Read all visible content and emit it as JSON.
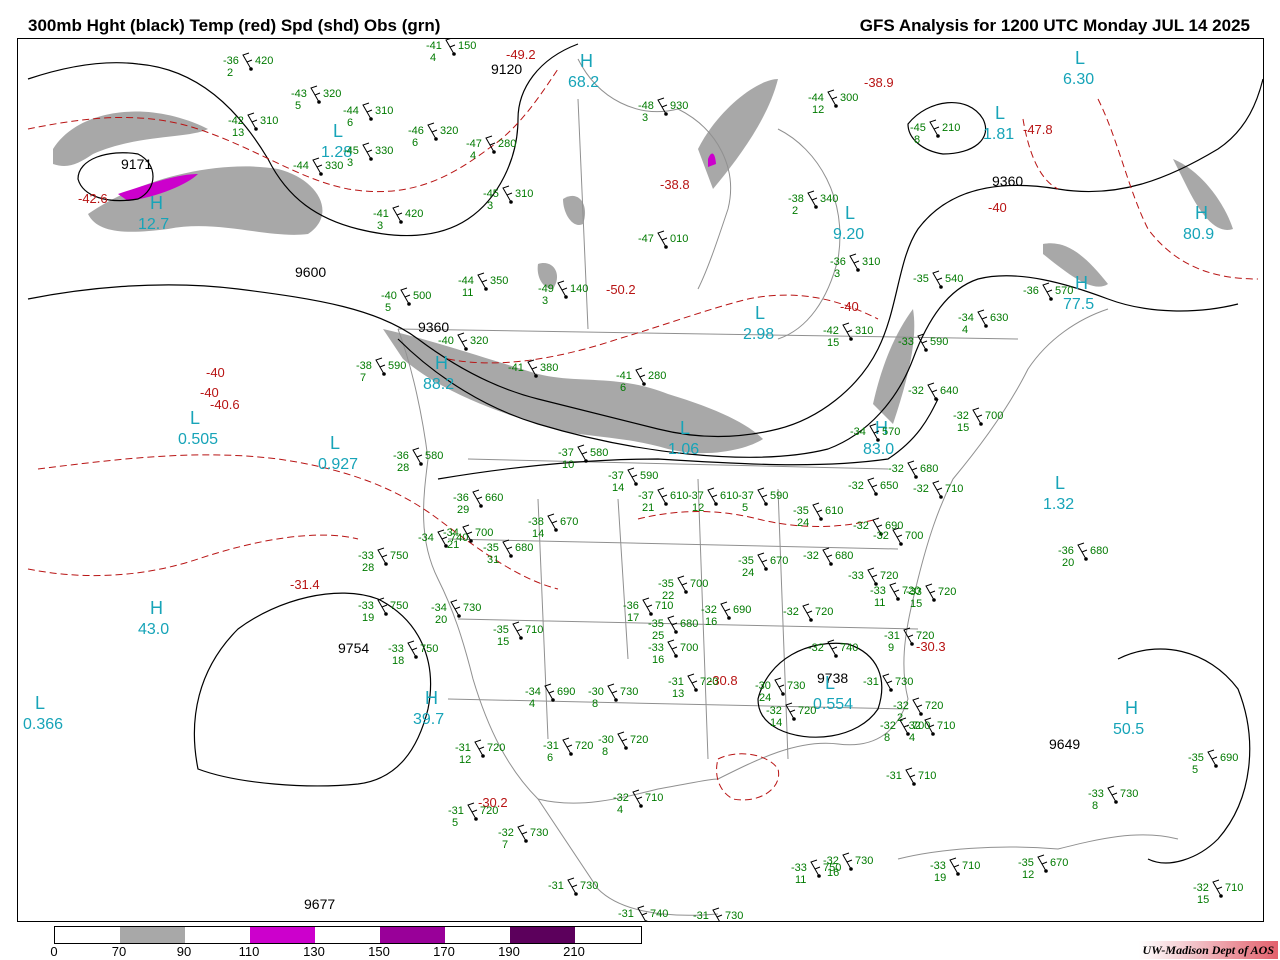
{
  "header": {
    "title_left": "300mb Hght (black) Temp (red) Spd (shd) Obs (grn)",
    "title_right": "GFS Analysis for 1200 UTC Monday  JUL 14 2025"
  },
  "colors": {
    "height_contour": "#000000",
    "temp_contour": "#b81414",
    "obs": "#007a00",
    "pressure_label": "#17a4b8",
    "borders": "#909090",
    "shade_70_90": "#a8a8a8",
    "shade_110_130": "#cc00cc",
    "shade_150_170": "#990099",
    "shade_190_210": "#5c005c"
  },
  "height_labels": [
    {
      "text": "9120"
    },
    {
      "text": "9171"
    },
    {
      "text": "9600"
    },
    {
      "text": "9360"
    },
    {
      "text": "9360"
    },
    {
      "text": "9754"
    },
    {
      "text": "9738"
    },
    {
      "text": "9677"
    },
    {
      "text": "9649"
    }
  ],
  "temp_labels": [
    {
      "text": "-49.2"
    },
    {
      "text": "-38.9"
    },
    {
      "text": "-47.8"
    },
    {
      "text": "-40"
    },
    {
      "text": "-50.2"
    },
    {
      "text": "-40"
    },
    {
      "text": "-40"
    },
    {
      "text": "-40.6"
    },
    {
      "text": "-40"
    },
    {
      "text": "-31.4"
    },
    {
      "text": "-30.8"
    },
    {
      "text": "-30.3"
    },
    {
      "text": "-30.2"
    },
    {
      "text": "-42.6"
    },
    {
      "text": "-38.8"
    }
  ],
  "pressure_centers": [
    {
      "type": "H",
      "value": "68.2"
    },
    {
      "type": "L",
      "value": "6.30"
    },
    {
      "type": "L",
      "value": "1.81"
    },
    {
      "type": "L",
      "value": "1.28"
    },
    {
      "type": "H",
      "value": "12.7"
    },
    {
      "type": "L",
      "value": "9.20"
    },
    {
      "type": "H",
      "value": "80.9"
    },
    {
      "type": "H",
      "value": "77.5"
    },
    {
      "type": "L",
      "value": "2.98"
    },
    {
      "type": "H",
      "value": "88.2"
    },
    {
      "type": "L",
      "value": "0.505"
    },
    {
      "type": "L",
      "value": "0.927"
    },
    {
      "type": "L",
      "value": "1.32"
    },
    {
      "type": "H",
      "value": "43.0"
    },
    {
      "type": "L",
      "value": "0.366"
    },
    {
      "type": "H",
      "value": "39.7"
    },
    {
      "type": "H",
      "value": "50.5"
    },
    {
      "type": "H",
      "value": "83.0"
    },
    {
      "type": "L",
      "value": "0.554"
    },
    {
      "type": "L",
      "value": "1.06"
    }
  ],
  "observations": [
    {
      "t": "-36",
      "d": "2",
      "h": "420"
    },
    {
      "t": "-43",
      "d": "5",
      "h": "320"
    },
    {
      "t": "-44",
      "d": "6",
      "h": "310"
    },
    {
      "t": "-42",
      "d": "13",
      "h": "310"
    },
    {
      "t": "-46",
      "d": "6",
      "h": "320"
    },
    {
      "t": "-45",
      "d": "3",
      "h": "330"
    },
    {
      "t": "-44",
      "d": "",
      "h": "330"
    },
    {
      "t": "-41",
      "d": "4",
      "h": "150"
    },
    {
      "t": "-47",
      "d": "4",
      "h": "280"
    },
    {
      "t": "-45",
      "d": "3",
      "h": "310"
    },
    {
      "t": "-41",
      "d": "3",
      "h": "420"
    },
    {
      "t": "-44",
      "d": "11",
      "h": "350"
    },
    {
      "t": "-49",
      "d": "3",
      "h": "140"
    },
    {
      "t": "-40",
      "d": "5",
      "h": "500"
    },
    {
      "t": "-47",
      "d": "",
      "h": "010"
    },
    {
      "t": "-48",
      "d": "3",
      "h": "930"
    },
    {
      "t": "-44",
      "d": "12",
      "h": "300"
    },
    {
      "t": "-45",
      "d": "8",
      "h": "210"
    },
    {
      "t": "-38",
      "d": "2",
      "h": "340"
    },
    {
      "t": "-36",
      "d": "3",
      "h": "310"
    },
    {
      "t": "-35",
      "d": "",
      "h": "540"
    },
    {
      "t": "-36",
      "d": "",
      "h": "570"
    },
    {
      "t": "-34",
      "d": "4",
      "h": "630"
    },
    {
      "t": "-42",
      "d": "15",
      "h": "310"
    },
    {
      "t": "-33",
      "d": "",
      "h": "590"
    },
    {
      "t": "-32",
      "d": "",
      "h": "640"
    },
    {
      "t": "-32",
      "d": "15",
      "h": "700"
    },
    {
      "t": "-34",
      "d": "",
      "h": "570"
    },
    {
      "t": "-40",
      "d": "",
      "h": "320"
    },
    {
      "t": "-38",
      "d": "7",
      "h": "590"
    },
    {
      "t": "-41",
      "d": "",
      "h": "380"
    },
    {
      "t": "-41",
      "d": "6",
      "h": "280"
    },
    {
      "t": "-37",
      "d": "10",
      "h": "580"
    },
    {
      "t": "-36",
      "d": "28",
      "h": "580"
    },
    {
      "t": "-36",
      "d": "29",
      "h": "660"
    },
    {
      "t": "-37",
      "d": "14",
      "h": "590"
    },
    {
      "t": "-37",
      "d": "21",
      "h": "610"
    },
    {
      "t": "-37",
      "d": "12",
      "h": "610"
    },
    {
      "t": "-37",
      "d": "5",
      "h": "590"
    },
    {
      "t": "-35",
      "d": "24",
      "h": "610"
    },
    {
      "t": "-32",
      "d": "",
      "h": "680"
    },
    {
      "t": "-32",
      "d": "",
      "h": "650"
    },
    {
      "t": "-32",
      "d": "",
      "h": "710"
    },
    {
      "t": "-38",
      "d": "14",
      "h": "670"
    },
    {
      "t": "-34",
      "d": "21",
      "h": "700"
    },
    {
      "t": "-35",
      "d": "31",
      "h": "680"
    },
    {
      "t": "-34",
      "d": "",
      "h": "740"
    },
    {
      "t": "-33",
      "d": "28",
      "h": "750"
    },
    {
      "t": "-32",
      "d": "",
      "h": "690"
    },
    {
      "t": "-32",
      "d": "",
      "h": "700"
    },
    {
      "t": "-36",
      "d": "20",
      "h": "680"
    },
    {
      "t": "-35",
      "d": "24",
      "h": "670"
    },
    {
      "t": "-32",
      "d": "",
      "h": "680"
    },
    {
      "t": "-33",
      "d": "",
      "h": "720"
    },
    {
      "t": "-33",
      "d": "11",
      "h": "720"
    },
    {
      "t": "-33",
      "d": "15",
      "h": "720"
    },
    {
      "t": "-33",
      "d": "19",
      "h": "750"
    },
    {
      "t": "-34",
      "d": "20",
      "h": "730"
    },
    {
      "t": "-35",
      "d": "15",
      "h": "710"
    },
    {
      "t": "-33",
      "d": "18",
      "h": "750"
    },
    {
      "t": "-35",
      "d": "22",
      "h": "700"
    },
    {
      "t": "-36",
      "d": "17",
      "h": "710"
    },
    {
      "t": "-35",
      "d": "25",
      "h": "680"
    },
    {
      "t": "-32",
      "d": "16",
      "h": "690"
    },
    {
      "t": "-33",
      "d": "16",
      "h": "700"
    },
    {
      "t": "-32",
      "d": "",
      "h": "720"
    },
    {
      "t": "-32",
      "d": "",
      "h": "740"
    },
    {
      "t": "-31",
      "d": "9",
      "h": "720"
    },
    {
      "t": "-31",
      "d": "13",
      "h": "720"
    },
    {
      "t": "-30",
      "d": "24",
      "h": "730"
    },
    {
      "t": "-32",
      "d": "14",
      "h": "720"
    },
    {
      "t": "-31",
      "d": "",
      "h": "730"
    },
    {
      "t": "-32",
      "d": "2",
      "h": "720"
    },
    {
      "t": "-32",
      "d": "4",
      "h": "710"
    },
    {
      "t": "-32",
      "d": "8",
      "h": "700"
    },
    {
      "t": "-34",
      "d": "4",
      "h": "690"
    },
    {
      "t": "-30",
      "d": "8",
      "h": "730"
    },
    {
      "t": "-30",
      "d": "8",
      "h": "720"
    },
    {
      "t": "-31",
      "d": "6",
      "h": "720"
    },
    {
      "t": "-31",
      "d": "12",
      "h": "720"
    },
    {
      "t": "-31",
      "d": "5",
      "h": "720"
    },
    {
      "t": "-32",
      "d": "4",
      "h": "710"
    },
    {
      "t": "-32",
      "d": "7",
      "h": "730"
    },
    {
      "t": "-31",
      "d": "",
      "h": "710"
    },
    {
      "t": "-31",
      "d": "",
      "h": "730"
    },
    {
      "t": "-31",
      "d": "",
      "h": "740"
    },
    {
      "t": "-31",
      "d": "",
      "h": "730"
    },
    {
      "t": "-33",
      "d": "11",
      "h": "750"
    },
    {
      "t": "-32",
      "d": "16",
      "h": "730"
    },
    {
      "t": "-33",
      "d": "19",
      "h": "710"
    },
    {
      "t": "-35",
      "d": "12",
      "h": "670"
    },
    {
      "t": "-35",
      "d": "5",
      "h": "690"
    },
    {
      "t": "-33",
      "d": "8",
      "h": "730"
    },
    {
      "t": "-32",
      "d": "15",
      "h": "710"
    }
  ],
  "colorbar": {
    "ticks": [
      "0",
      "70",
      "90",
      "110",
      "130",
      "150",
      "170",
      "190",
      "210"
    ]
  },
  "credit": "UW-Madison  Dept of AOS"
}
